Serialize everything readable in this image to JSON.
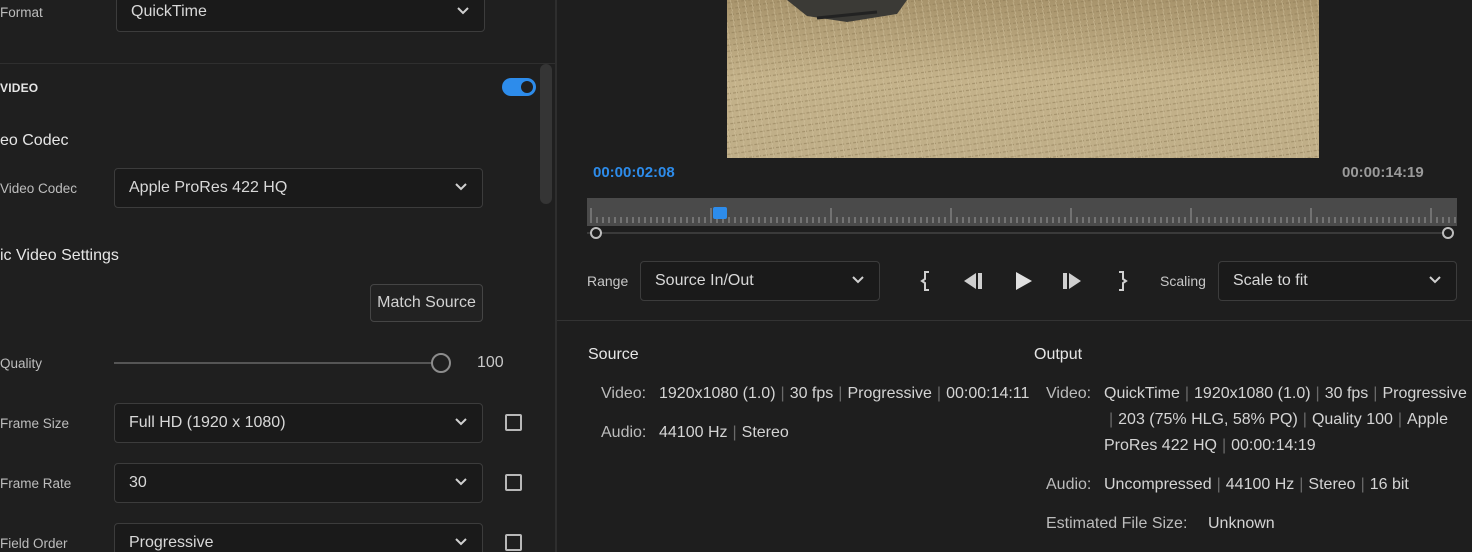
{
  "export_settings": {
    "format": {
      "label": "Format",
      "value": "QuickTime"
    },
    "video_section": {
      "title": "VIDEO",
      "enabled": true
    },
    "video_codec_heading": "eo Codec",
    "video_codec": {
      "label": "Video Codec",
      "value": "Apple ProRes 422 HQ"
    },
    "basic_settings_heading": "ic Video Settings",
    "match_source_label": "Match Source",
    "quality": {
      "label": "Quality",
      "value": "100",
      "level": 1.0
    },
    "frame_size": {
      "label": "Frame Size",
      "value": "Full HD (1920 x 1080)"
    },
    "frame_rate": {
      "label": "Frame Rate",
      "value": "30"
    },
    "field_order": {
      "label": "Field Order",
      "value": "Progressive"
    }
  },
  "preview": {
    "current_timecode": "00:00:02:08",
    "duration_timecode": "00:00:14:19",
    "playhead_fraction": 0.153,
    "range": {
      "label": "Range",
      "value": "Source In/Out"
    },
    "scaling": {
      "label": "Scaling",
      "value": "Scale to fit"
    },
    "controls": [
      "set-in-icon",
      "step-back-icon",
      "play-icon",
      "step-forward-icon",
      "set-out-icon"
    ]
  },
  "source": {
    "title": "Source",
    "video_key": "Video:",
    "video_parts": [
      "1920x1080 (1.0)",
      "30 fps",
      "Progressive",
      "00:00:14:11"
    ],
    "audio_key": "Audio:",
    "audio_parts": [
      "44100 Hz",
      "Stereo"
    ]
  },
  "output": {
    "title": "Output",
    "video_key": "Video:",
    "video_line1": [
      "QuickTime",
      "1920x1080 (1.0)",
      "30 fps",
      "Progressive"
    ],
    "video_line2": [
      "203 (75% HLG, 58% PQ)",
      "Quality 100",
      "Apple"
    ],
    "video_line3": [
      "ProRes 422 HQ",
      "00:00:14:19"
    ],
    "audio_key": "Audio:",
    "audio_parts": [
      "Uncompressed",
      "44100 Hz",
      "Stereo",
      "16 bit"
    ],
    "file_size_key": "Estimated File Size:",
    "file_size_value": "Unknown"
  },
  "colors": {
    "accent": "#2d8ceb",
    "background": "#1e1e1e"
  }
}
